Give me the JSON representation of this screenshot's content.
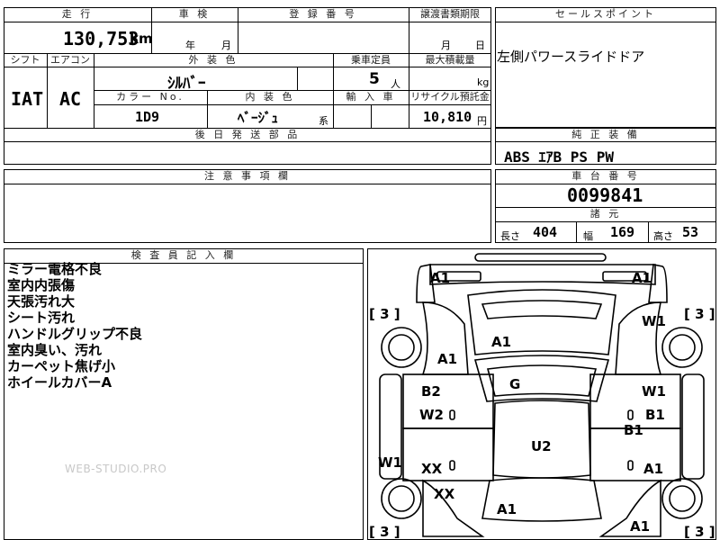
{
  "top": {
    "mileage_header": "走 行",
    "mileage_value": "130,753",
    "mileage_unit": "km",
    "inspection_header": "車 検",
    "inspection_year": "年",
    "inspection_month": "月",
    "registration_header": "登 録 番 号",
    "transfer_header": "譲渡書類期限",
    "transfer_month": "月",
    "transfer_day": "日",
    "shift_header": "シフト",
    "ac_header": "エアコン",
    "shift_value": "IAT",
    "ac_value": "AC",
    "exterior_color_header": "外 装 色",
    "exterior_color_value": "ｼﾙﾊﾞｰ",
    "capacity_header": "乗車定員",
    "capacity_value": "5",
    "capacity_unit": "人",
    "max_load_header": "最大積載量",
    "max_load_unit": "kg",
    "color_no_header": "カラー No.",
    "color_no_value": "1D9",
    "interior_color_header": "内 装 色",
    "interior_color_value": "ﾍﾞｰｼﾞｭ",
    "interior_color_suffix": "系",
    "import_header": "輸 入 車",
    "recycle_header": "リサイクル預託金",
    "recycle_value": "10,810",
    "recycle_unit": "円",
    "delivery_header": "後 日 発 送 部 品"
  },
  "selling_points": {
    "header": "セールスポイント",
    "text": "左側パワースライドドア"
  },
  "equipment": {
    "header": "純 正 装 備",
    "text": "ABS ｴｱB PS PW"
  },
  "caution": {
    "header": "注 意 事 項 欄"
  },
  "chassis": {
    "header": "車 台 番 号",
    "value": "0099841"
  },
  "dimensions": {
    "header": "諸 元",
    "length_label": "長さ",
    "length_value": "404",
    "width_label": "幅",
    "width_value": "169",
    "height_label": "高さ",
    "height_value": "53"
  },
  "inspector": {
    "header": "検 査 員 記 入 欄",
    "notes": [
      "ミラー電格不良",
      "室内内張傷",
      "天張汚れ大",
      "シート汚れ",
      "ハンドルグリップ不良",
      "室内臭い、汚れ",
      "カーペット焦げ小",
      "ホイールカバーA"
    ]
  },
  "watermark": "WEB-STUDIO.PRO",
  "diagram": {
    "labels": {
      "front_left_corner": "A1",
      "front_right_corner": "A1",
      "right_front_fender": "W1",
      "hood": "A1",
      "left_front_fender": "A1",
      "windshield": "G",
      "left_front_door_top": "B2",
      "left_front_door_bottom": "W2",
      "right_front_door_top": "W1",
      "right_front_door_bottom": "B1",
      "right_pillar": "B1",
      "roof": "U2",
      "left_sill": "W1",
      "left_rear_door": "XX",
      "right_rear_door": "A1",
      "left_rear_fender": "XX",
      "rear_center": "A1",
      "rear_right_corner": "A1"
    },
    "brackets": {
      "front_left_wheel": "[ 3 ]",
      "front_right_wheel": "[ 3 ]",
      "rear_left_wheel": "[ 3 ]",
      "rear_right_wheel": "[ 3 ]"
    }
  }
}
